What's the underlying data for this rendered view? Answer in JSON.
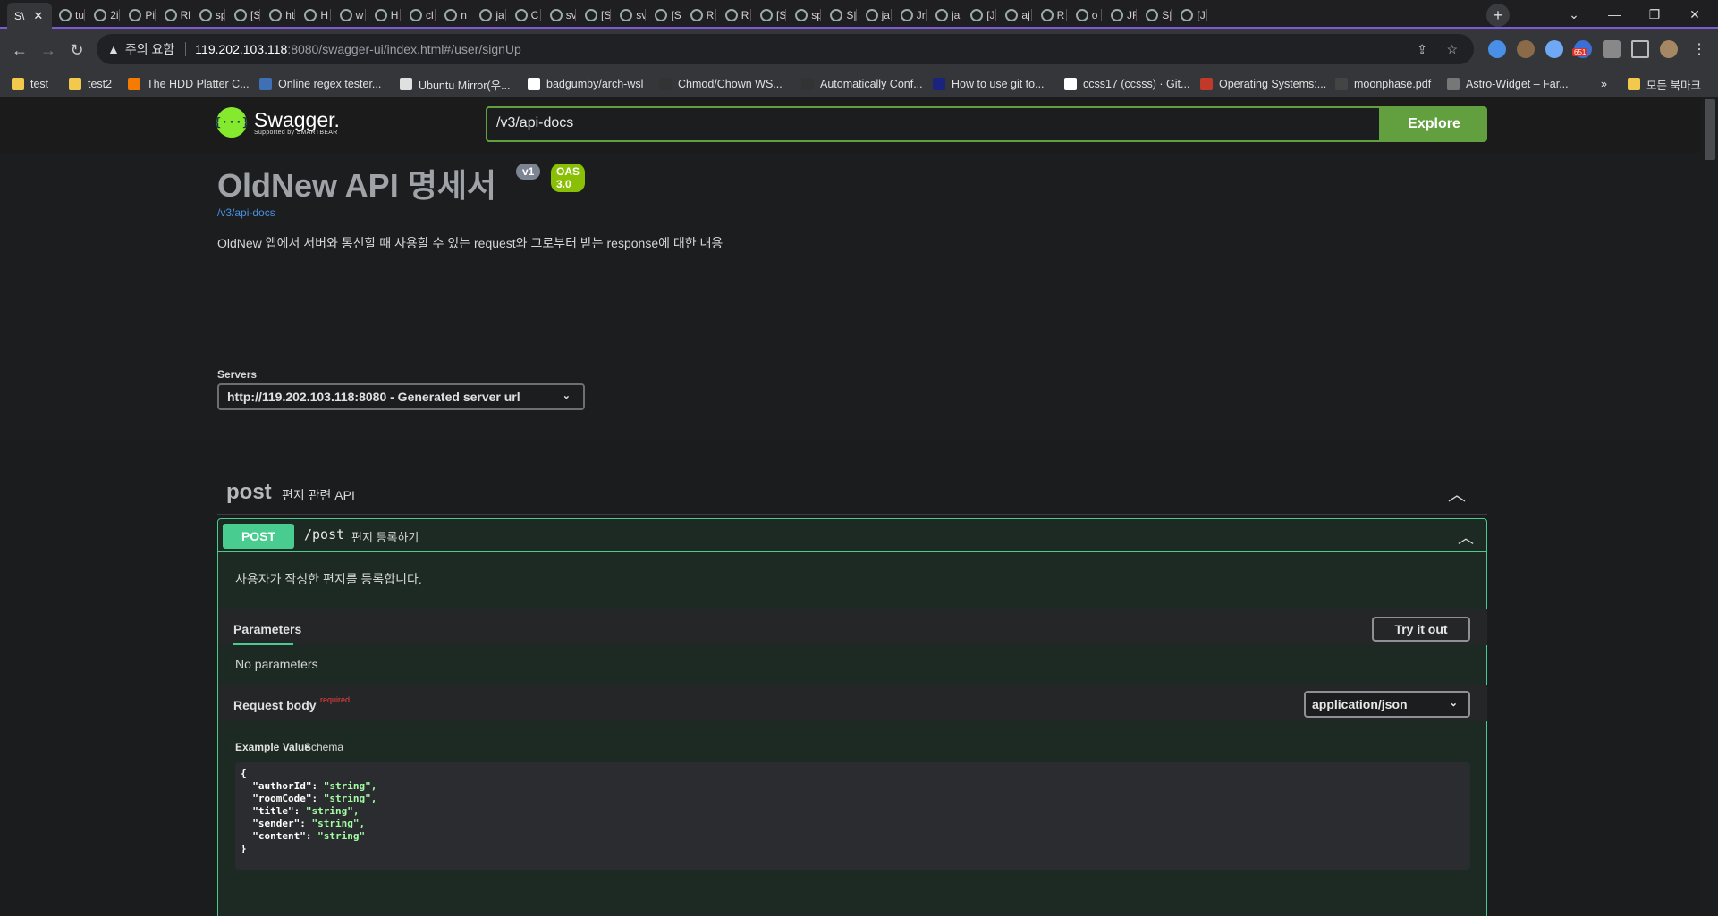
{
  "browser": {
    "active_tab_label": "S\\",
    "tabs": [
      "tu",
      "2i",
      "Pi",
      "Rl",
      "sp",
      "[S",
      "ht",
      "H",
      "w",
      "H",
      "cl",
      "n",
      "ja",
      "C",
      "sv",
      "[S",
      "sv",
      "[S",
      "R",
      "R",
      "[S",
      "sp",
      "S|",
      "ja",
      "Jr",
      "ja",
      "[J",
      "aj",
      "R",
      "o",
      "JF",
      "S|",
      "[J"
    ],
    "new_tab_symbol": "+",
    "close_symbol": "✕",
    "security_warning": "주의 요함",
    "url_host": "119.202.103.118",
    "url_rest": ":8080/swagger-ui/index.html#/user/signUp",
    "extension_badge": "651",
    "bookmarks": [
      {
        "label": "test",
        "icon_color": "#f2c94c"
      },
      {
        "label": "test2",
        "icon_color": "#f2c94c"
      },
      {
        "label": "The HDD Platter C...",
        "icon_color": "#f57c00"
      },
      {
        "label": "Online regex tester...",
        "icon_color": "#3f6fb5"
      },
      {
        "label": "Ubuntu Mirror(우...",
        "icon_color": "#e0e0e0"
      },
      {
        "label": "badgumby/arch-wsl",
        "icon_color": "#ffffff"
      },
      {
        "label": "Chmod/Chown WS...",
        "icon_color": "#333333"
      },
      {
        "label": "Automatically Conf...",
        "icon_color": "#333333"
      },
      {
        "label": "How to use git to...",
        "icon_color": "#1a237e"
      },
      {
        "label": "ccss17 (ccsss) · Git...",
        "icon_color": "#ffffff"
      },
      {
        "label": "Operating Systems:...",
        "icon_color": "#c0392b"
      },
      {
        "label": "moonphase.pdf",
        "icon_color": "#444444"
      },
      {
        "label": "Astro-Widget – Far...",
        "icon_color": "#777777"
      }
    ],
    "bookmarks_overflow": "»",
    "all_bookmarks": "모든 북마크"
  },
  "swagger": {
    "logo_icon": "{···}",
    "logo_name": "Swagger.",
    "logo_by": "Supported by SMARTBEAR",
    "spec_url": "/v3/api-docs",
    "explore_label": "Explore",
    "title": "OldNew API 명세서",
    "version_badge": "v1",
    "oas_badge": "OAS 3.0",
    "spec_link": "/v3/api-docs",
    "description": "OldNew 앱에서 서버와 통신할 때 사용할 수 있는 request와 그로부터 받는 response에 대한 내용",
    "servers_label": "Servers",
    "server_selected": "http://119.202.103.118:8080 - Generated server url",
    "tag": {
      "name": "post",
      "description": "편지 관련 API"
    },
    "operation": {
      "method": "POST",
      "path": "/post",
      "summary": "편지 등록하기",
      "description": "사용자가 작성한 편지를 등록합니다.",
      "parameters_title": "Parameters",
      "try_it_out": "Try it out",
      "no_parameters": "No parameters",
      "request_body_title": "Request body",
      "required_label": "required",
      "content_type": "application/json",
      "example_value_tab": "Example Value",
      "schema_tab": "Schema",
      "example_lines": [
        {
          "key": "",
          "value": "{"
        },
        {
          "key": "  \"authorId\": ",
          "value": "\"string\","
        },
        {
          "key": "  \"roomCode\": ",
          "value": "\"string\","
        },
        {
          "key": "  \"title\": ",
          "value": "\"string\","
        },
        {
          "key": "  \"sender\": ",
          "value": "\"string\","
        },
        {
          "key": "  \"content\": ",
          "value": "\"string\""
        },
        {
          "key": "",
          "value": "}"
        }
      ]
    }
  },
  "colors": {
    "swagger_green": "#62a03f",
    "post_green": "#49cc90",
    "link_blue": "#4990e2",
    "tab_accent": "#7d5bd6"
  }
}
